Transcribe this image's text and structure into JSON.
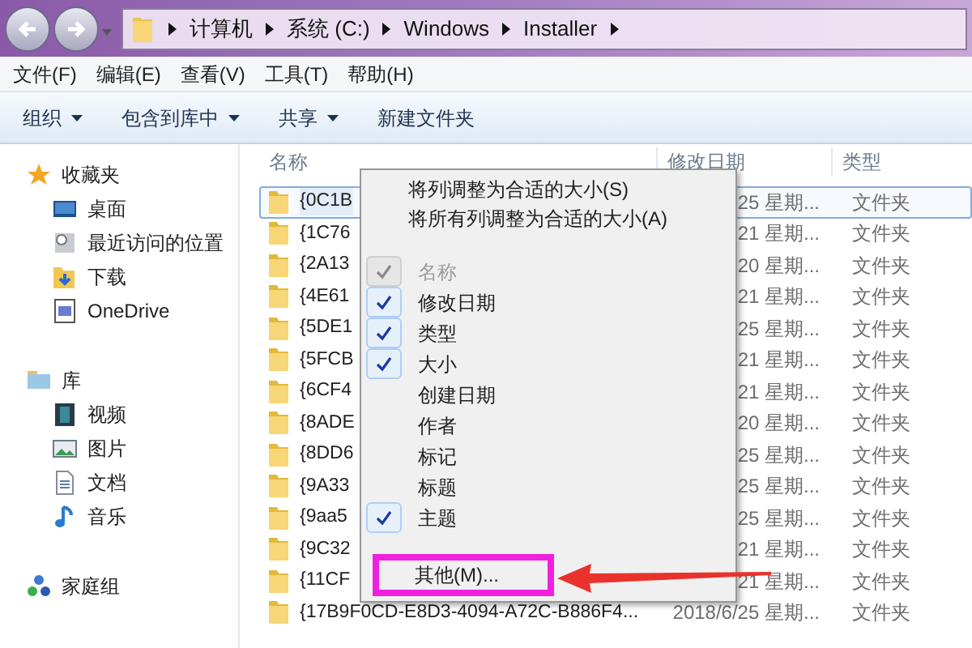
{
  "address_bar": {
    "crumbs": [
      "计算机",
      "系统 (C:)",
      "Windows",
      "Installer"
    ]
  },
  "menu_bar": [
    "文件(F)",
    "编辑(E)",
    "查看(V)",
    "工具(T)",
    "帮助(H)"
  ],
  "toolbar": [
    {
      "label": "组织",
      "dropdown": true
    },
    {
      "label": "包含到库中",
      "dropdown": true
    },
    {
      "label": "共享",
      "dropdown": true
    },
    {
      "label": "新建文件夹",
      "dropdown": false
    }
  ],
  "sidebar": {
    "groups": [
      {
        "label": "收藏夹",
        "kind": "star",
        "children": [
          {
            "label": "桌面",
            "kind": "desktop"
          },
          {
            "label": "最近访问的位置",
            "kind": "recent"
          },
          {
            "label": "下载",
            "kind": "download"
          },
          {
            "label": "OneDrive",
            "kind": "app"
          }
        ]
      },
      {
        "label": "库",
        "kind": "library",
        "children": [
          {
            "label": "视频",
            "kind": "video"
          },
          {
            "label": "图片",
            "kind": "picture"
          },
          {
            "label": "文档",
            "kind": "document"
          },
          {
            "label": "音乐",
            "kind": "music"
          }
        ]
      },
      {
        "label": "家庭组",
        "kind": "homegroup"
      }
    ]
  },
  "table": {
    "columns": [
      "名称",
      "修改日期",
      "类型"
    ],
    "rows": [
      {
        "name": "{0C1B",
        "date": "25 星期...",
        "type": "文件夹",
        "selected": true
      },
      {
        "name": "{1C76",
        "date": "21 星期...",
        "type": "文件夹",
        "selected": false
      },
      {
        "name": "{2A13",
        "date": "20 星期...",
        "type": "文件夹",
        "selected": false
      },
      {
        "name": "{4E61",
        "date": "21 星期...",
        "type": "文件夹",
        "selected": false
      },
      {
        "name": "{5DE1",
        "date": "25 星期...",
        "type": "文件夹",
        "selected": false
      },
      {
        "name": "{5FCB",
        "date": "21 星期...",
        "type": "文件夹",
        "selected": false
      },
      {
        "name": "{6CF4",
        "date": "21 星期...",
        "type": "文件夹",
        "selected": false
      },
      {
        "name": "{8ADE",
        "date": "20 星期...",
        "type": "文件夹",
        "selected": false
      },
      {
        "name": "{8DD6",
        "date": "25 星期...",
        "type": "文件夹",
        "selected": false
      },
      {
        "name": "{9A33",
        "date": "25 星期...",
        "type": "文件夹",
        "selected": false
      },
      {
        "name": "{9aa5",
        "date": "25 星期...",
        "type": "文件夹",
        "selected": false
      },
      {
        "name": "{9C32",
        "date": "21 星期...",
        "type": "文件夹",
        "selected": false
      },
      {
        "name": "{11CF",
        "date": "21 星期...",
        "type": "文件夹",
        "selected": false
      },
      {
        "name": "{17B9F0CD-E8D3-4094-A72C-B886F4...",
        "date": "2018/6/25 星期...",
        "type": "文件夹",
        "selected": false
      }
    ]
  },
  "context_menu": {
    "top_items": [
      "将列调整为合适的大小(S)",
      "将所有列调整为合适的大小(A)"
    ],
    "columns": [
      {
        "label": "名称",
        "checked": true,
        "disabled": true
      },
      {
        "label": "修改日期",
        "checked": true,
        "disabled": false
      },
      {
        "label": "类型",
        "checked": true,
        "disabled": false
      },
      {
        "label": "大小",
        "checked": true,
        "disabled": false
      },
      {
        "label": "创建日期",
        "checked": false,
        "disabled": false
      },
      {
        "label": "作者",
        "checked": false,
        "disabled": false
      },
      {
        "label": "标记",
        "checked": false,
        "disabled": false
      },
      {
        "label": "标题",
        "checked": false,
        "disabled": false
      },
      {
        "label": "主题",
        "checked": true,
        "disabled": false
      }
    ],
    "more": {
      "label": "其他(M)...",
      "highlighted": true
    }
  }
}
